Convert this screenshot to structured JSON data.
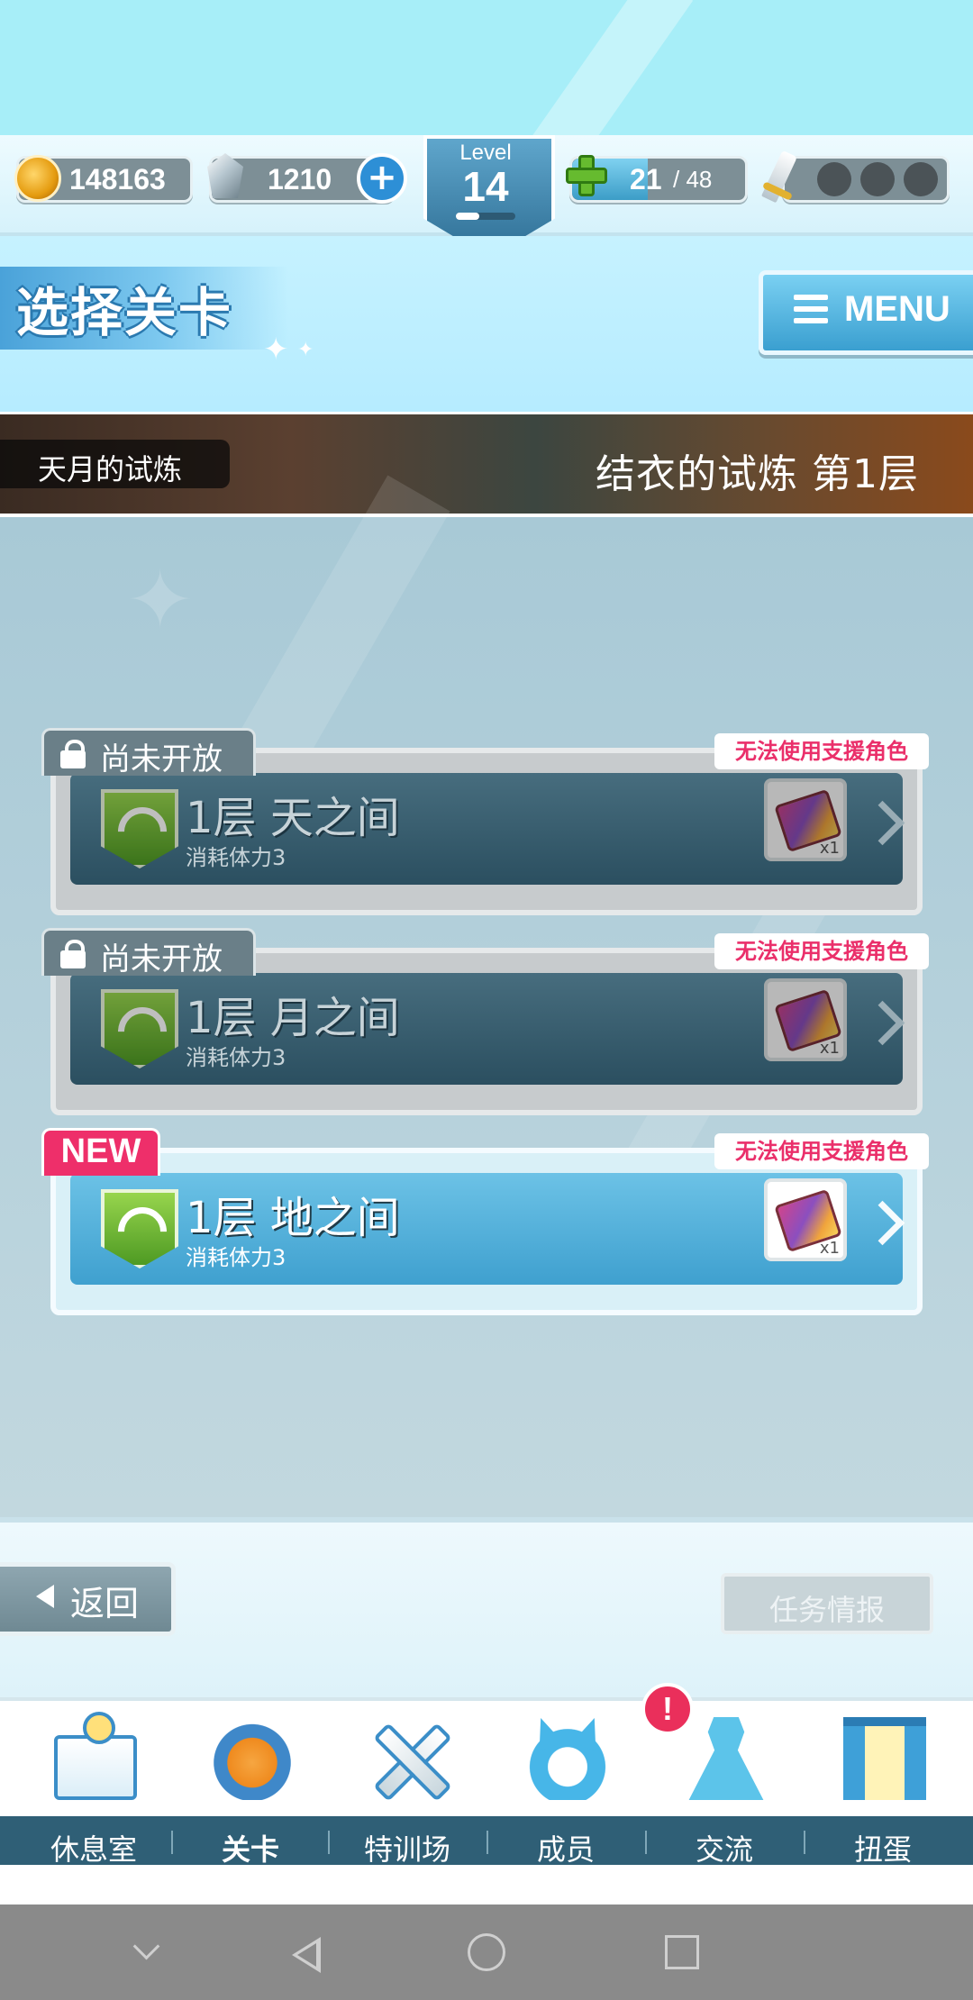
{
  "status": {
    "gold": "148163",
    "gems": "1210",
    "level_label": "Level",
    "level": "14",
    "stamina_current": "21",
    "stamina_max": "/ 48",
    "stamina_fraction": 0.4375
  },
  "header": {
    "title": "选择关卡",
    "menu_label": "MENU"
  },
  "stage_header": {
    "chapter": "天月的试炼",
    "floor_title": "结衣的试炼  第1层"
  },
  "stages": [
    {
      "status_tag": "尚未开放",
      "restriction": "无法使用支援角色",
      "name": "1层  天之间",
      "cost": "消耗体力3",
      "reward_count": "x1",
      "reward_icon": "ticket-icon"
    },
    {
      "status_tag": "尚未开放",
      "restriction": "无法使用支援角色",
      "name": "1层  月之间",
      "cost": "消耗体力3",
      "reward_count": "x1",
      "reward_icon": "ticket-icon"
    },
    {
      "status_tag": "NEW",
      "restriction": "无法使用支援角色",
      "name": "1层  地之间",
      "cost": "消耗体力3",
      "reward_count": "x1",
      "reward_icon": "ticket-icon"
    }
  ],
  "footer": {
    "back_label": "返回",
    "mission_label": "任务情报"
  },
  "nav": {
    "items": [
      {
        "label": "休息室",
        "icon": "building-icon"
      },
      {
        "label": "关卡",
        "icon": "demon-icon"
      },
      {
        "label": "特训场",
        "icon": "crossed-swords-icon"
      },
      {
        "label": "成员",
        "icon": "cat-icon"
      },
      {
        "label": "交流",
        "icon": "dress-icon"
      },
      {
        "label": "扭蛋",
        "icon": "curtain-icon"
      }
    ],
    "alert": "!"
  },
  "colors": {
    "accent": "#3fa0cf",
    "new_badge": "#ee2f6a",
    "restriction_text": "#ea2f6a",
    "nav_bg": "#2f5f76"
  }
}
